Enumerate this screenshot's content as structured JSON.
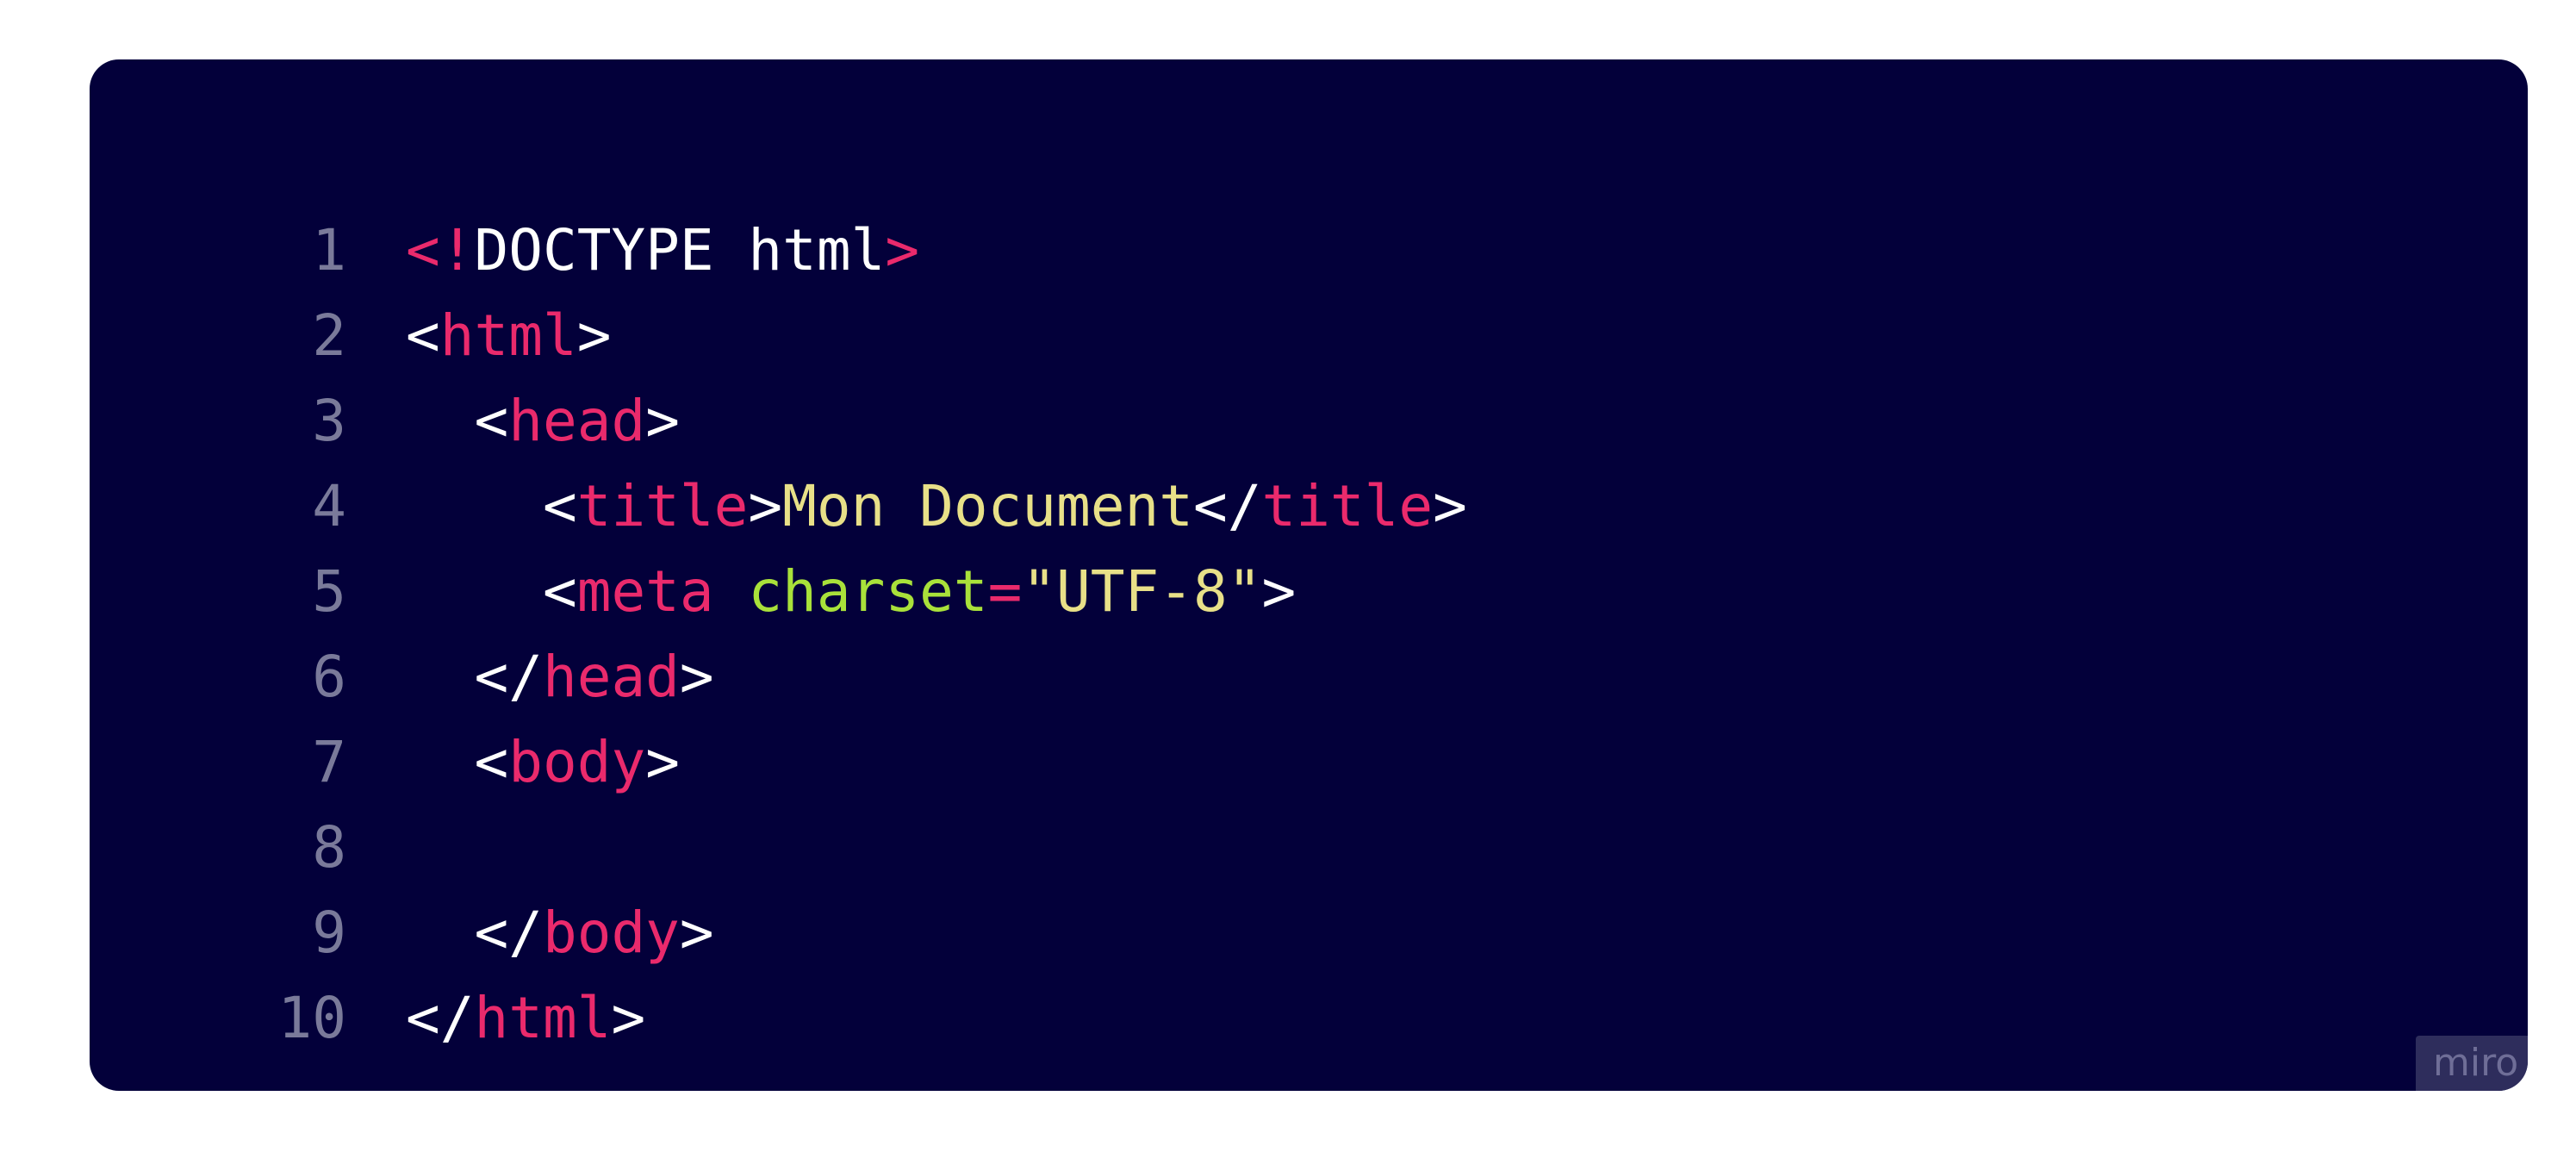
{
  "colors": {
    "background": "#ffffff",
    "card": "#03003a",
    "line_number": "#7a7a9a",
    "punctuation": "#ffffff",
    "tag": "#ea2a6c",
    "attribute": "#a9e13a",
    "string": "#e8e088",
    "text": "#e8e088"
  },
  "watermark": {
    "label": "miro"
  },
  "code": {
    "lines": [
      {
        "number": "1",
        "tokens": [
          {
            "type": "bang",
            "text": "<!"
          },
          {
            "type": "plain",
            "text": "DOCTYPE html"
          },
          {
            "type": "bang",
            "text": ">"
          }
        ]
      },
      {
        "number": "2",
        "tokens": [
          {
            "type": "punct",
            "text": "<"
          },
          {
            "type": "tag",
            "text": "html"
          },
          {
            "type": "punct",
            "text": ">"
          }
        ]
      },
      {
        "number": "3",
        "tokens": [
          {
            "type": "plain",
            "text": "  "
          },
          {
            "type": "punct",
            "text": "<"
          },
          {
            "type": "tag",
            "text": "head"
          },
          {
            "type": "punct",
            "text": ">"
          }
        ]
      },
      {
        "number": "4",
        "tokens": [
          {
            "type": "plain",
            "text": "    "
          },
          {
            "type": "punct",
            "text": "<"
          },
          {
            "type": "tag",
            "text": "title"
          },
          {
            "type": "punct",
            "text": ">"
          },
          {
            "type": "text",
            "text": "Mon Document"
          },
          {
            "type": "punct",
            "text": "</"
          },
          {
            "type": "tag",
            "text": "title"
          },
          {
            "type": "punct",
            "text": ">"
          }
        ]
      },
      {
        "number": "5",
        "tokens": [
          {
            "type": "plain",
            "text": "    "
          },
          {
            "type": "punct",
            "text": "<"
          },
          {
            "type": "tag",
            "text": "meta"
          },
          {
            "type": "plain",
            "text": " "
          },
          {
            "type": "attr",
            "text": "charset"
          },
          {
            "type": "eq",
            "text": "="
          },
          {
            "type": "str",
            "text": "\"UTF-8\""
          },
          {
            "type": "punct",
            "text": ">"
          }
        ]
      },
      {
        "number": "6",
        "tokens": [
          {
            "type": "plain",
            "text": "  "
          },
          {
            "type": "punct",
            "text": "</"
          },
          {
            "type": "tag",
            "text": "head"
          },
          {
            "type": "punct",
            "text": ">"
          }
        ]
      },
      {
        "number": "7",
        "tokens": [
          {
            "type": "plain",
            "text": "  "
          },
          {
            "type": "punct",
            "text": "<"
          },
          {
            "type": "tag",
            "text": "body"
          },
          {
            "type": "punct",
            "text": ">"
          }
        ]
      },
      {
        "number": "8",
        "tokens": []
      },
      {
        "number": "9",
        "tokens": [
          {
            "type": "plain",
            "text": "  "
          },
          {
            "type": "punct",
            "text": "</"
          },
          {
            "type": "tag",
            "text": "body"
          },
          {
            "type": "punct",
            "text": ">"
          }
        ]
      },
      {
        "number": "10",
        "tokens": [
          {
            "type": "punct",
            "text": "</"
          },
          {
            "type": "tag",
            "text": "html"
          },
          {
            "type": "punct",
            "text": ">"
          }
        ]
      }
    ]
  }
}
